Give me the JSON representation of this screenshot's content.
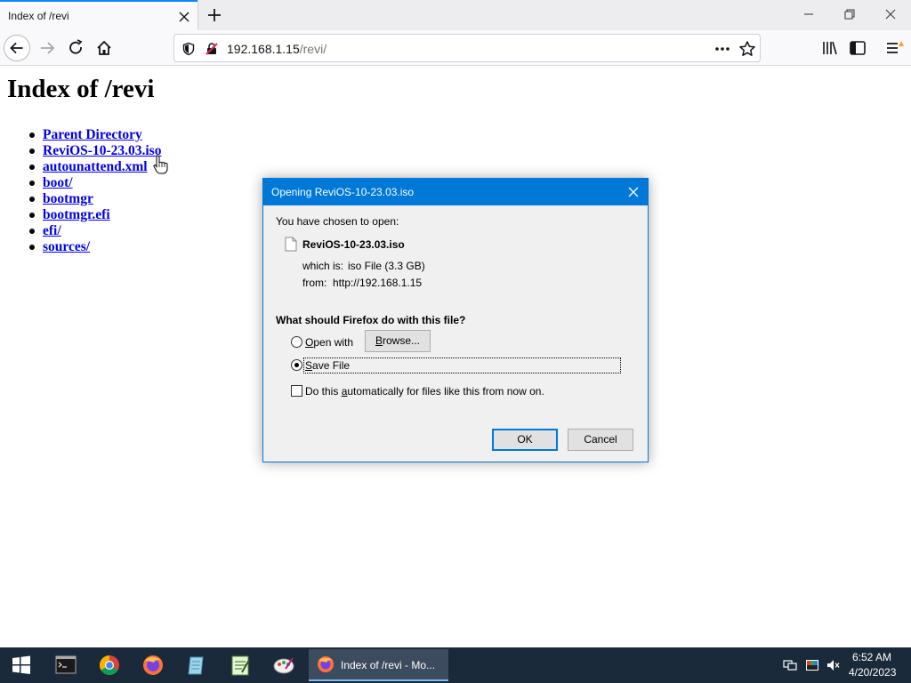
{
  "browser": {
    "tab_title": "Index of /revi",
    "url_host": "192.168.1.15",
    "url_path": "/revi/"
  },
  "page": {
    "heading": "Index of /revi",
    "entries": [
      "Parent Directory",
      "ReviOS-10-23.03.iso",
      "autounattend.xml",
      "boot/",
      "bootmgr",
      "bootmgr.efi",
      "efi/",
      "sources/"
    ]
  },
  "dialog": {
    "title": "Opening ReviOS-10-23.03.iso",
    "chosen_label": "You have chosen to open:",
    "file_name": "ReviOS-10-23.03.iso",
    "which_is_label": "which is:",
    "which_is_value": "iso File (3.3 GB)",
    "from_label": "from:",
    "from_value": "http://192.168.1.15",
    "question": "What should Firefox do with this file?",
    "open_with_accel": "O",
    "open_with_rest": "pen with",
    "browse_accel": "B",
    "browse_rest": "rowse...",
    "save_accel": "S",
    "save_rest": "ave File",
    "selected_option": "Save File",
    "auto_pre": "Do this ",
    "auto_accel": "a",
    "auto_rest": "utomatically for files like this from now on.",
    "auto_checked": false,
    "ok_label": "OK",
    "cancel_label": "Cancel"
  },
  "taskbar": {
    "active_window": "Index of /revi - Mo...",
    "time": "6:52 AM",
    "date": "4/20/2023"
  },
  "colors": {
    "accent": "#0078d7",
    "link": "#0000ee",
    "taskbar": "#1b2a3a"
  }
}
